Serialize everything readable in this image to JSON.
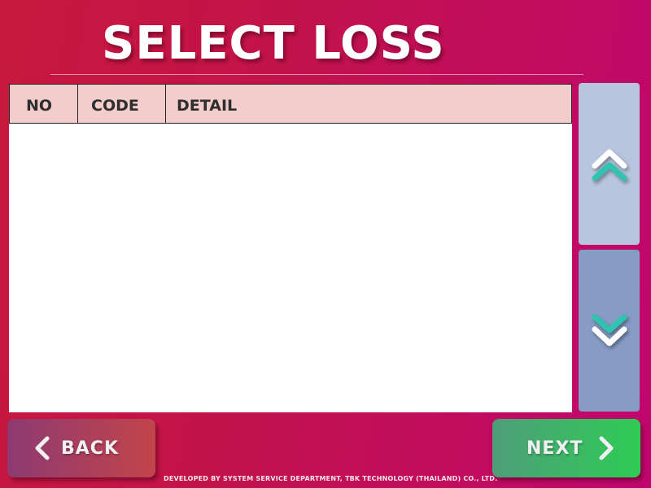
{
  "page": {
    "title": "SELECT LOSS"
  },
  "table": {
    "columns": [
      "NO",
      "CODE",
      "DETAIL"
    ],
    "rows": []
  },
  "scroll": {
    "up_icon": "double-chevron-up-icon",
    "down_icon": "double-chevron-down-icon"
  },
  "buttons": {
    "back_label": "BACK",
    "next_label": "NEXT"
  },
  "footer": {
    "text": "DEVELOPED BY SYSTEM SERVICE DEPARTMENT, TBK TECHNOLOGY (THAILAND) CO., LTD."
  },
  "colors": {
    "background_left": "#c8183c",
    "background_right": "#c0066e",
    "header_fill": "#f2cdcb",
    "scroll_up_fill": "#b8c5de",
    "scroll_down_fill": "#869cc5",
    "chevron_accent": "#2ec4b0",
    "back_gradient_start": "#8e3a72",
    "back_gradient_end": "#c2444a",
    "next_gradient_start": "#4e9e7a",
    "next_gradient_end": "#2ecc55"
  }
}
